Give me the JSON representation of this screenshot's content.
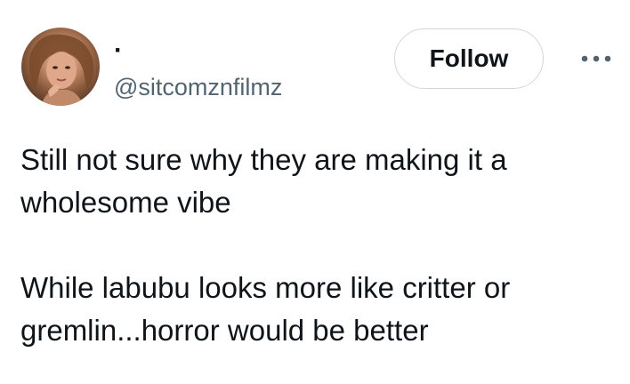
{
  "author": {
    "display_name": "·",
    "handle": "@sitcomznfilmz"
  },
  "actions": {
    "follow_label": "Follow",
    "more_icon": "more-horizontal-icon"
  },
  "tweet": {
    "paragraphs": [
      "Still not sure why they are making it a wholesome vibe",
      "While labubu looks more like critter or gremlin...horror would be better"
    ]
  }
}
